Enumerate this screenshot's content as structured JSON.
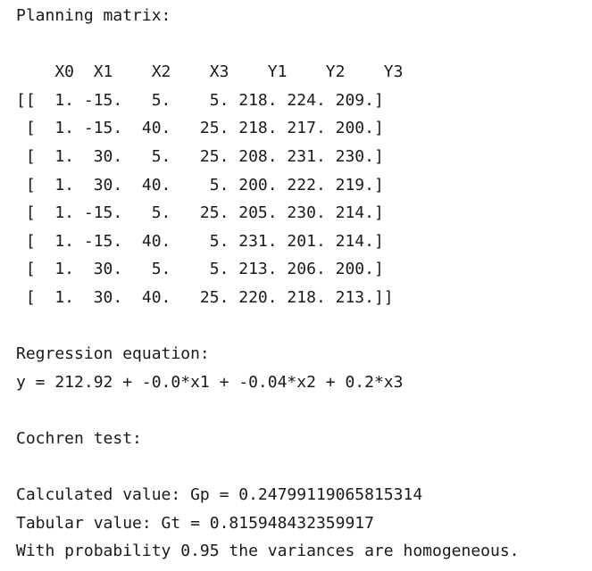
{
  "console": {
    "lines": [
      "Planning matrix:",
      "",
      "    X0  X1    X2    X3    Y1    Y2    Y3",
      "[[  1. -15.   5.    5. 218. 224. 209.]",
      " [  1. -15.  40.   25. 218. 217. 200.]",
      " [  1.  30.   5.   25. 208. 231. 230.]",
      " [  1.  30.  40.    5. 200. 222. 219.]",
      " [  1. -15.   5.   25. 205. 230. 214.]",
      " [  1. -15.  40.    5. 231. 201. 214.]",
      " [  1.  30.   5.    5. 213. 206. 200.]",
      " [  1.  30.  40.   25. 220. 218. 213.]]",
      "",
      "Regression equation:",
      "y = 212.92 + -0.0*x1 + -0.04*x2 + 0.2*x3",
      "",
      "Cochren test:",
      "",
      "Calculated value: Gp = 0.24799119065815314",
      "Tabular value: Gt = 0.815948432359917",
      "With probability 0.95 the variances are homogeneous."
    ]
  }
}
